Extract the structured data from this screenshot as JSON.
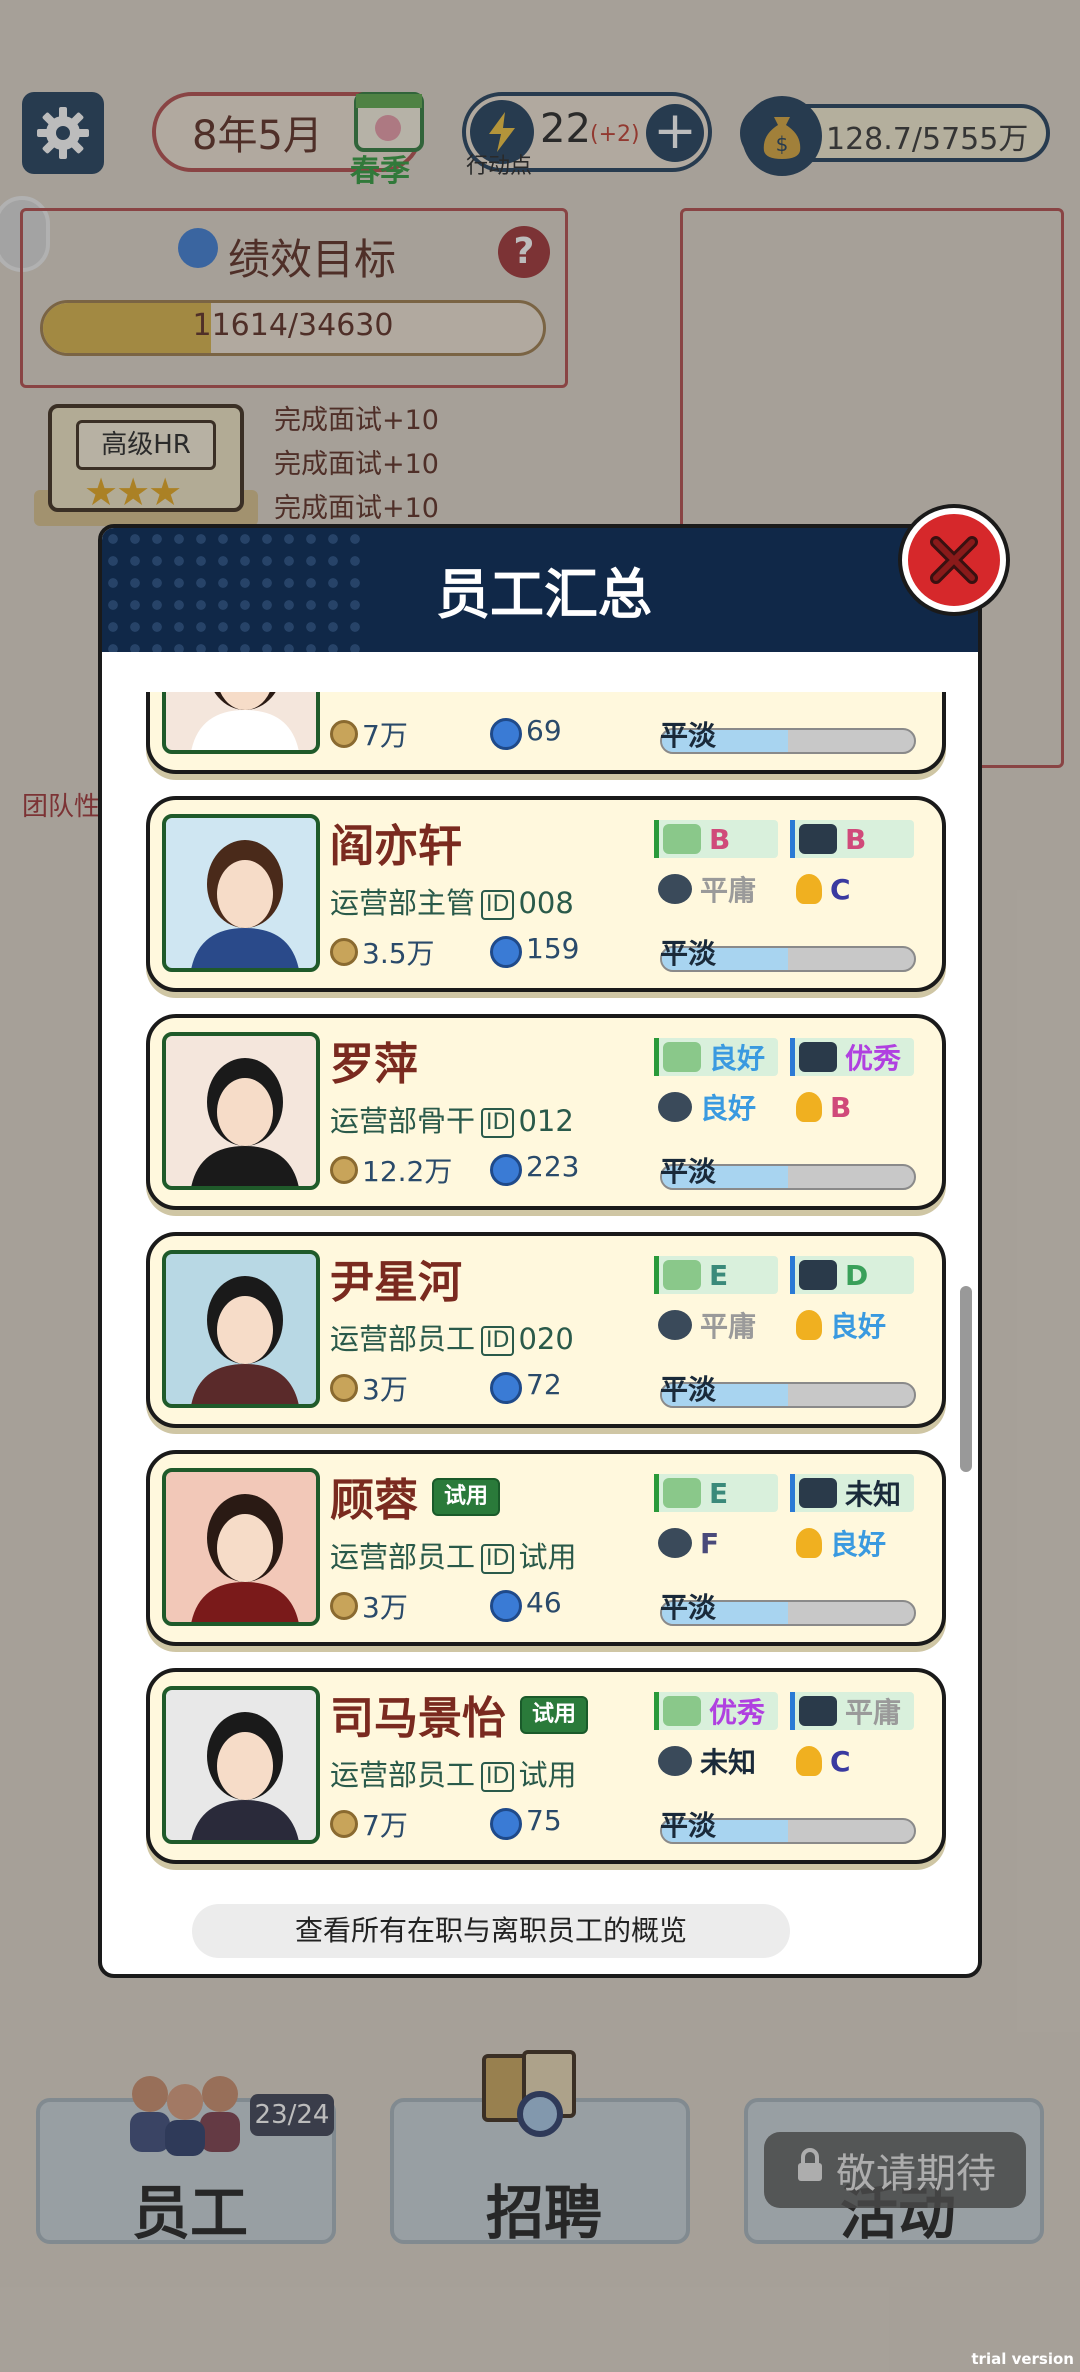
{
  "top_bar": {
    "settings_icon": "gear-icon",
    "date": "8年5月",
    "season": "春季",
    "action_points": "22",
    "action_points_bonus": "(+2)",
    "action_points_label": "行动点",
    "money": "128.7/5755万"
  },
  "goal": {
    "title": "绩效目标",
    "help": "?",
    "progress_text": "11614/34630",
    "progress_fraction": 0.3354
  },
  "hr": {
    "title": "高级HR",
    "stars": "★★★",
    "lines": [
      "完成面试+10",
      "完成面试+10",
      "完成面试+10"
    ]
  },
  "team_label": "团队性",
  "modal": {
    "title": "员工汇总",
    "footer": "查看所有在职与离职员工的概览",
    "employees": [
      {
        "name": "",
        "dept": "",
        "id": "",
        "salary": "7万",
        "performance": "69",
        "mood": "平淡",
        "mood_level": 0.5,
        "trial": false,
        "skills": []
      },
      {
        "name": "阎亦轩",
        "dept": "运营部主管",
        "id": "008",
        "salary": "3.5万",
        "performance": "159",
        "mood": "平淡",
        "mood_level": 0.5,
        "trial": false,
        "skills": [
          "B",
          "B",
          "平庸",
          "C"
        ]
      },
      {
        "name": "罗萍",
        "dept": "运营部骨干",
        "id": "012",
        "salary": "12.2万",
        "performance": "223",
        "mood": "平淡",
        "mood_level": 0.5,
        "trial": false,
        "skills": [
          "良好",
          "优秀",
          "良好",
          "B"
        ]
      },
      {
        "name": "尹星河",
        "dept": "运营部员工",
        "id": "020",
        "salary": "3万",
        "performance": "72",
        "mood": "平淡",
        "mood_level": 0.5,
        "trial": false,
        "skills": [
          "E",
          "D",
          "平庸",
          "良好"
        ]
      },
      {
        "name": "顾蓉",
        "dept": "运营部员工",
        "id": "试用",
        "salary": "3万",
        "performance": "46",
        "mood": "平淡",
        "mood_level": 0.5,
        "trial": true,
        "trial_label": "试用",
        "skills": [
          "E",
          "未知",
          "F",
          "良好"
        ]
      },
      {
        "name": "司马景怡",
        "dept": "运营部员工",
        "id": "试用",
        "salary": "7万",
        "performance": "75",
        "mood": "平淡",
        "mood_level": 0.5,
        "trial": true,
        "trial_label": "试用",
        "skills": [
          "优秀",
          "平庸",
          "未知",
          "C"
        ]
      }
    ]
  },
  "nav": {
    "staff_label": "员工",
    "staff_count": "23/24",
    "recruit_label": "招聘",
    "activity_label": "活动",
    "coming_soon": "敬请期待"
  },
  "watermark": "trial version",
  "colors": {
    "navy": "#102848",
    "close_red": "#d6282b",
    "card_bg": "#fff8dd"
  }
}
